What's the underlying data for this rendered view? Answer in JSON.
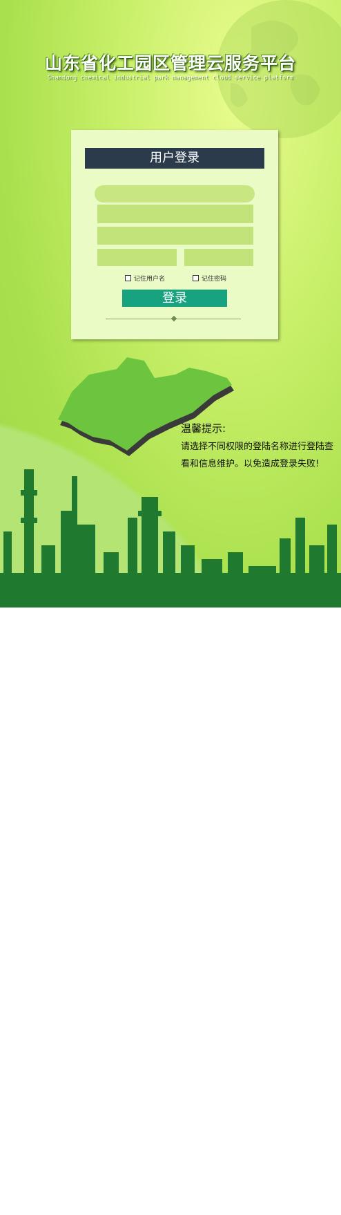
{
  "header": {
    "title": "山东省化工园区管理云服务平台",
    "subtitle": "Shandong chemical industrial park management cloud service platform"
  },
  "login_panel": {
    "title": "用户登录",
    "remember_username_label": "记住用户名",
    "remember_password_label": "记住密码",
    "login_button_label": "登录"
  },
  "tip": {
    "title": "温馨提示:",
    "text": "请选择不同权限的登陆名称进行登陆查看和信息维护。以免造成登录失败!"
  },
  "colors": {
    "panel_title_bg": "#2b3b4c",
    "login_button_bg": "#18a380",
    "field_bg": "#c2e27a",
    "skyline": "#1f7a2f"
  }
}
